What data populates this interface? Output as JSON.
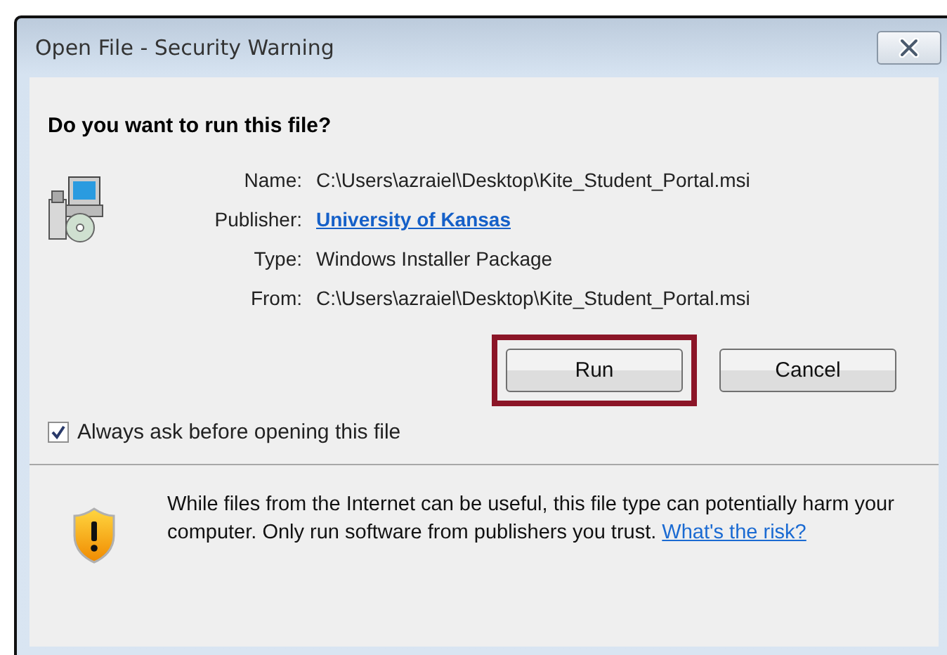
{
  "window": {
    "title": "Open File - Security Warning"
  },
  "question": "Do you want to run this file?",
  "details": [
    {
      "label": "Name:",
      "value": "C:\\Users\\azraiel\\Desktop\\Kite_Student_Portal.msi",
      "kind": "text"
    },
    {
      "label": "Publisher:",
      "value": "University of Kansas",
      "kind": "link"
    },
    {
      "label": "Type:",
      "value": "Windows Installer Package",
      "kind": "text"
    },
    {
      "label": "From:",
      "value": "C:\\Users\\azraiel\\Desktop\\Kite_Student_Portal.msi",
      "kind": "text"
    }
  ],
  "buttons": [
    {
      "label": "Run",
      "highlighted": true
    },
    {
      "label": "Cancel",
      "highlighted": false
    }
  ],
  "always_ask": {
    "label": "Always ask before opening this file",
    "checked": true
  },
  "warning": {
    "text": "While files from the Internet can be useful, this file type can potentially harm your computer. Only run software from publishers you trust.",
    "link": "What's the risk?"
  }
}
